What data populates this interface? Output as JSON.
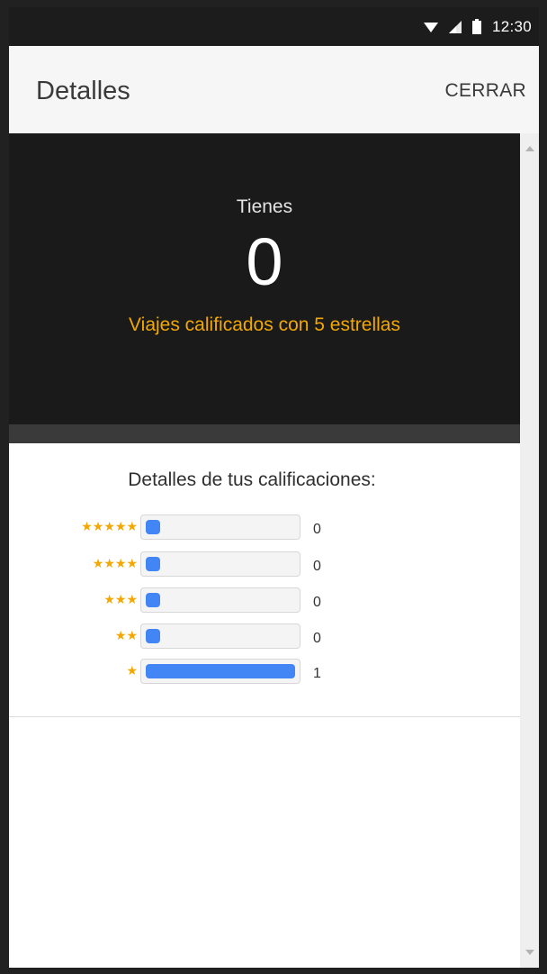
{
  "status_bar": {
    "time": "12:30",
    "icons": [
      "wifi-icon",
      "cell-signal-icon",
      "battery-icon"
    ]
  },
  "app_bar": {
    "title": "Detalles",
    "close_label": "CERRAR"
  },
  "hero": {
    "prefix": "Tienes",
    "count": "0",
    "label": "Viajes calificados con 5 estrellas"
  },
  "ratings": {
    "heading": "Detalles de tus calificaciones:",
    "rows": [
      {
        "stars": "★★★★★",
        "value": "0",
        "fraction": 0
      },
      {
        "stars": "★★★★",
        "value": "0",
        "fraction": 0
      },
      {
        "stars": "★★★",
        "value": "0",
        "fraction": 0
      },
      {
        "stars": "★★",
        "value": "0",
        "fraction": 0
      },
      {
        "stars": "★",
        "value": "1",
        "fraction": 1
      }
    ]
  },
  "colors": {
    "accent": "#f2a800",
    "bar": "#4285f4",
    "hero_bg": "#1a1a1a"
  }
}
